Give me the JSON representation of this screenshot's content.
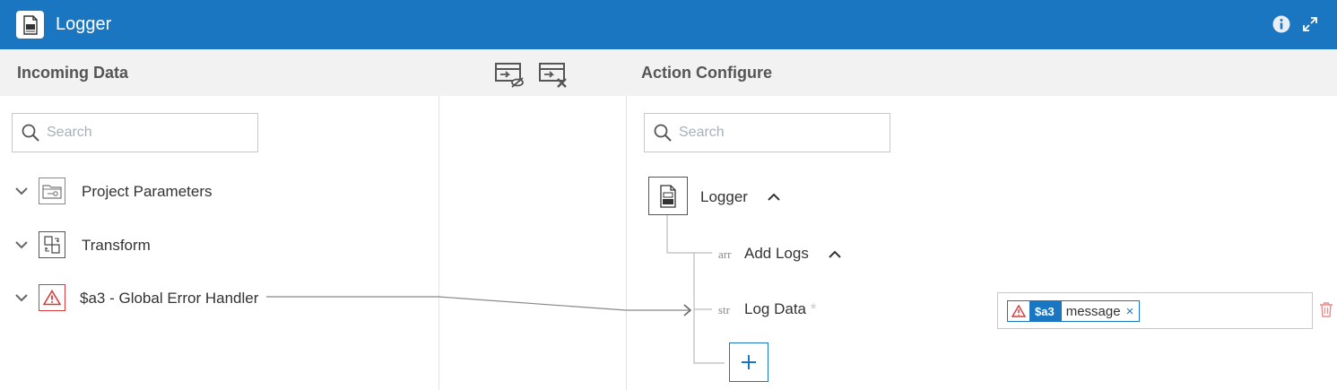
{
  "app": {
    "title": "Logger",
    "icon": "log-file-icon"
  },
  "header": {
    "info_icon": "info-icon",
    "expand_icon": "expand-icon"
  },
  "left_panel": {
    "title": "Incoming Data",
    "search_placeholder": "Search",
    "items": [
      {
        "label": "Project Parameters",
        "icon": "folder-key-icon"
      },
      {
        "label": "Transform",
        "icon": "transform-icon"
      },
      {
        "label": "$a3 - Global Error Handler",
        "icon": "warning-icon"
      }
    ]
  },
  "toolbar": {
    "show_mapped_icon": "mapping-hide-icon",
    "remove_mapping_icon": "mapping-remove-icon"
  },
  "right_panel": {
    "title": "Action Configure",
    "search_placeholder": "Search",
    "root": {
      "label": "Logger",
      "icon": "log-file-icon"
    },
    "add_logs": {
      "type": "arr",
      "label": "Add Logs"
    },
    "log_data": {
      "type": "str",
      "label": "Log Data",
      "required_mark": "*"
    },
    "add_button": "+"
  },
  "mapping": {
    "source": "$a3",
    "field": "message",
    "remove": "×"
  },
  "colors": {
    "primary": "#1a76c1",
    "error": "#d93a3a",
    "header_bg": "#f2f2f2"
  }
}
